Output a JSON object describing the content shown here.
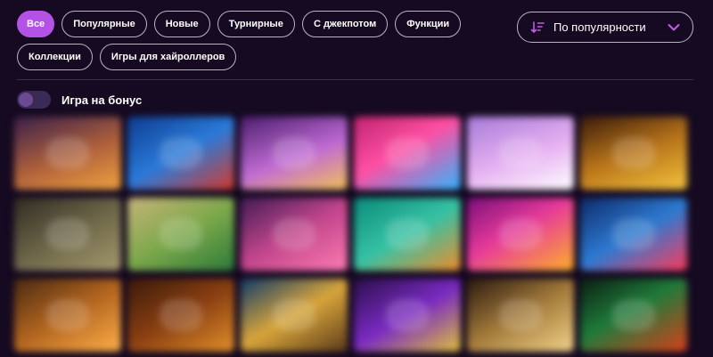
{
  "filters": [
    {
      "label": "Все",
      "active": true
    },
    {
      "label": "Популярные",
      "active": false
    },
    {
      "label": "Новые",
      "active": false
    },
    {
      "label": "Турнирные",
      "active": false
    },
    {
      "label": "С джекпотом",
      "active": false
    },
    {
      "label": "Функции",
      "active": false
    },
    {
      "label": "Коллекции",
      "active": false
    },
    {
      "label": "Игры для хайроллеров",
      "active": false
    }
  ],
  "sort": {
    "label": "По популярности",
    "icon": "sort-descending-icon",
    "chevron_icon": "chevron-down-icon",
    "accent_color": "#c45ae8"
  },
  "bonus_toggle": {
    "label": "Игра на бонус",
    "enabled": false
  },
  "colors": {
    "background": "#150a21",
    "active_chip": "#b452e6",
    "chip_border": "#b9b3c4",
    "toggle_track": "#3b2a55"
  },
  "games_grid": {
    "columns": 6,
    "tile_count": 18,
    "blurred": true
  }
}
